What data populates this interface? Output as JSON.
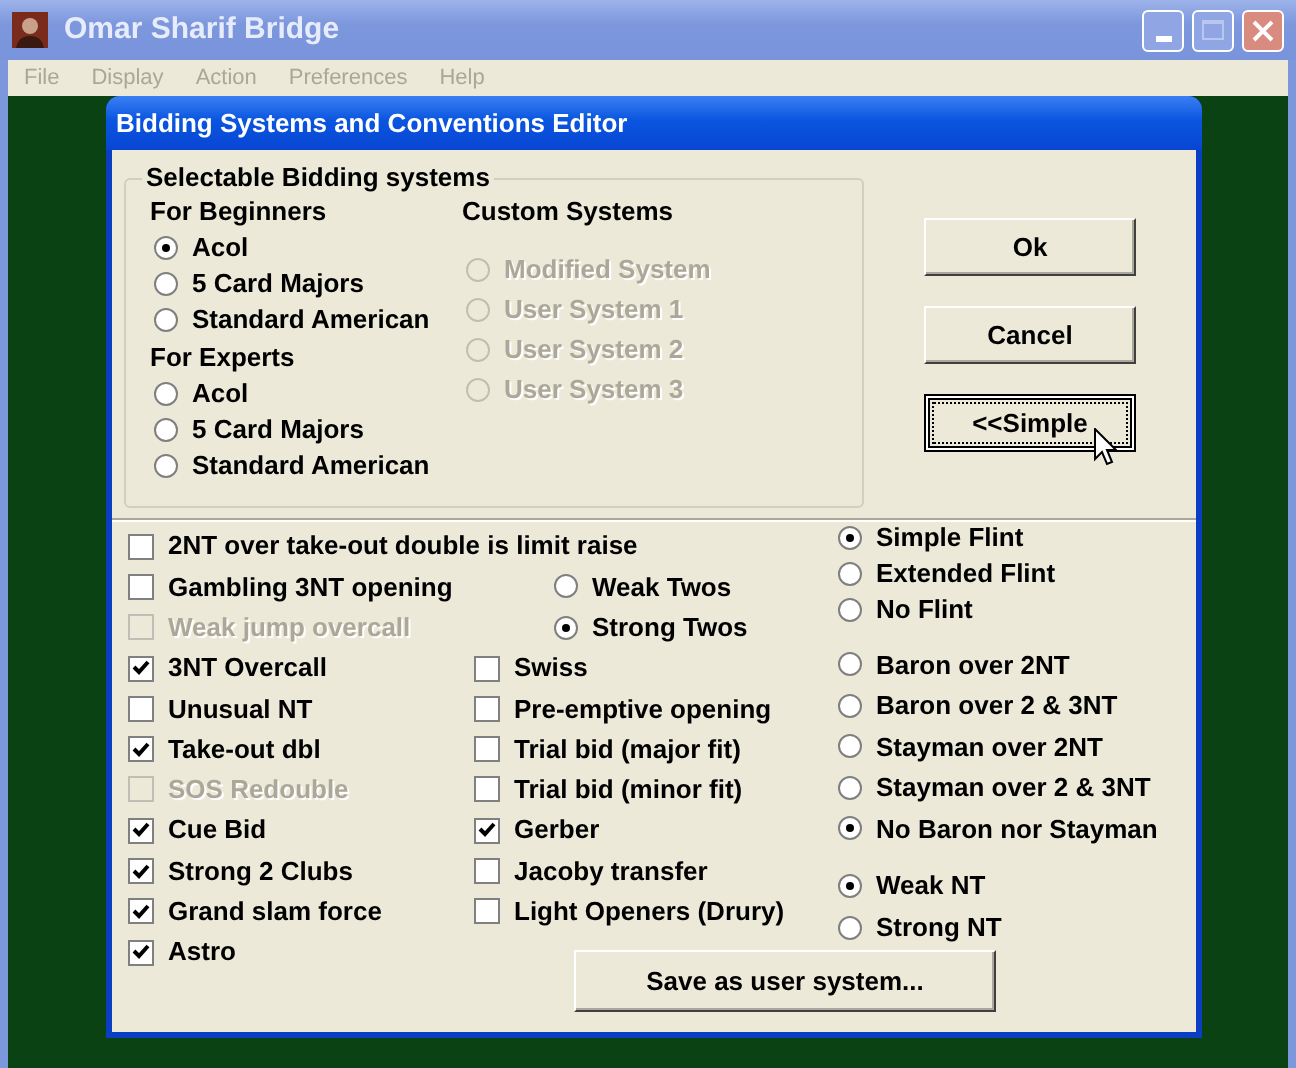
{
  "window": {
    "title": "Omar Sharif Bridge"
  },
  "menu": [
    "File",
    "Display",
    "Action",
    "Preferences",
    "Help"
  ],
  "dialog": {
    "title": "Bidding Systems and Conventions Editor",
    "systems": {
      "legend": "Selectable Bidding systems",
      "groups": [
        {
          "heading": "For Beginners",
          "options": [
            {
              "label": "Acol",
              "selected": true,
              "disabled": false
            },
            {
              "label": "5 Card Majors",
              "selected": false,
              "disabled": false
            },
            {
              "label": "Standard American",
              "selected": false,
              "disabled": false
            }
          ]
        },
        {
          "heading": "For Experts",
          "options": [
            {
              "label": "Acol",
              "selected": false,
              "disabled": false
            },
            {
              "label": "5 Card Majors",
              "selected": false,
              "disabled": false
            },
            {
              "label": "Standard American",
              "selected": false,
              "disabled": false
            }
          ]
        },
        {
          "heading": "Custom Systems",
          "options": [
            {
              "label": "Modified System",
              "selected": false,
              "disabled": true
            },
            {
              "label": "User System 1",
              "selected": false,
              "disabled": true
            },
            {
              "label": "User System 2",
              "selected": false,
              "disabled": true
            },
            {
              "label": "User System 3",
              "selected": false,
              "disabled": true
            }
          ]
        }
      ]
    },
    "buttons": [
      {
        "label": "Ok",
        "focused": false
      },
      {
        "label": "Cancel",
        "focused": false
      },
      {
        "label": "<<Simple",
        "focused": true
      }
    ],
    "left_options": [
      {
        "label": "2NT over take-out double is limit raise",
        "checked": false,
        "disabled": false
      },
      {
        "label": "Gambling 3NT opening",
        "checked": false,
        "disabled": false
      },
      {
        "label": "Weak jump overcall",
        "checked": false,
        "disabled": true
      },
      {
        "label": "3NT Overcall",
        "checked": true,
        "disabled": false
      },
      {
        "label": "Unusual NT",
        "checked": false,
        "disabled": false
      },
      {
        "label": "Take-out dbl",
        "checked": true,
        "disabled": false
      },
      {
        "label": "SOS Redouble",
        "checked": false,
        "disabled": true
      },
      {
        "label": "Cue Bid",
        "checked": true,
        "disabled": false
      },
      {
        "label": "Strong 2 Clubs",
        "checked": true,
        "disabled": false
      },
      {
        "label": "Grand slam force",
        "checked": true,
        "disabled": false
      },
      {
        "label": "Astro",
        "checked": true,
        "disabled": false
      }
    ],
    "twos": [
      {
        "label": "Weak Twos",
        "selected": false,
        "disabled": false
      },
      {
        "label": "Strong Twos",
        "selected": true,
        "disabled": false
      }
    ],
    "middle_options": [
      {
        "label": "Swiss",
        "checked": false,
        "disabled": false
      },
      {
        "label": "Pre-emptive opening",
        "checked": false,
        "disabled": false
      },
      {
        "label": "Trial bid (major fit)",
        "checked": false,
        "disabled": false
      },
      {
        "label": "Trial bid (minor fit)",
        "checked": false,
        "disabled": false
      },
      {
        "label": "Gerber",
        "checked": true,
        "disabled": false
      },
      {
        "label": "Jacoby transfer",
        "checked": false,
        "disabled": false
      },
      {
        "label": "Light Openers (Drury)",
        "checked": false,
        "disabled": false
      }
    ],
    "save_button": "Save as user system...",
    "flint": [
      {
        "label": "Simple Flint",
        "selected": true,
        "disabled": false
      },
      {
        "label": "Extended Flint",
        "selected": false,
        "disabled": false
      },
      {
        "label": "No Flint",
        "selected": false,
        "disabled": false
      }
    ],
    "baron_stayman": [
      {
        "label": "Baron over 2NT",
        "selected": false,
        "disabled": false
      },
      {
        "label": "Baron over 2 & 3NT",
        "selected": false,
        "disabled": false
      },
      {
        "label": "Stayman over 2NT",
        "selected": false,
        "disabled": false
      },
      {
        "label": "Stayman over 2 & 3NT",
        "selected": false,
        "disabled": false
      },
      {
        "label": "No Baron nor Stayman",
        "selected": true,
        "disabled": false
      }
    ],
    "no_trump": [
      {
        "label": "Weak NT",
        "selected": true,
        "disabled": false
      },
      {
        "label": "Strong NT",
        "selected": false,
        "disabled": false
      }
    ]
  }
}
